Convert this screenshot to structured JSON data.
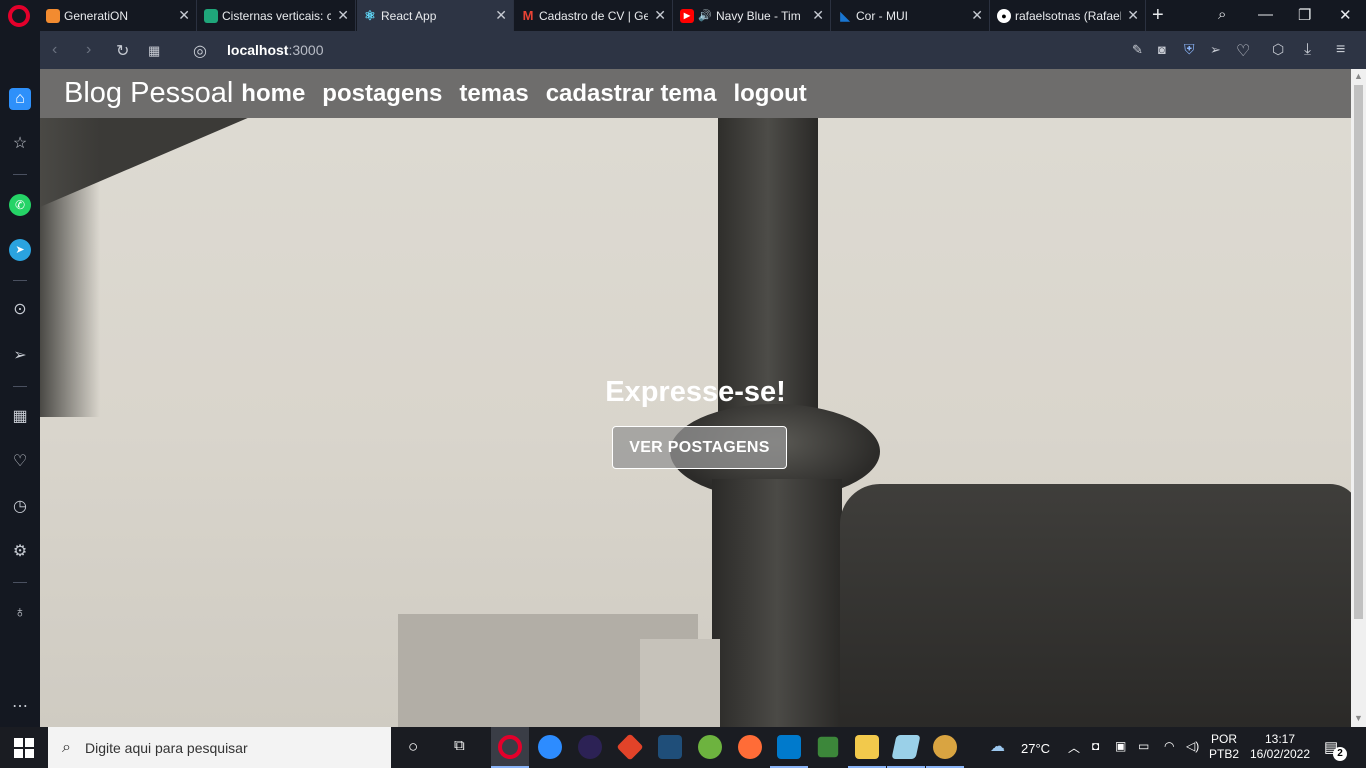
{
  "browser": {
    "tabs": [
      {
        "title": "GeneratiON",
        "favicon_color": "#f28b30",
        "active": false
      },
      {
        "title": "Cisternas verticais: c",
        "favicon_color": "#1fa67a",
        "active": false
      },
      {
        "title": "React App",
        "favicon_color": "#61dafb",
        "active": true
      },
      {
        "title": "Cadastro de CV | Ge",
        "favicon_color": "#ea4335",
        "active": false
      },
      {
        "title": "Navy Blue - Tim",
        "favicon_color": "#ff0000",
        "active": false
      },
      {
        "title": "Cor - MUI",
        "favicon_color": "#1976d2",
        "active": false
      },
      {
        "title": "rafaelsotnas (Rafael",
        "favicon_color": "#ffffff",
        "active": false
      }
    ],
    "address": {
      "host": "localhost",
      "port": ":3000"
    }
  },
  "page": {
    "navbar": {
      "brand": "Blog Pessoal",
      "items": [
        "home",
        "postagens",
        "temas",
        "cadastrar tema",
        "logout"
      ]
    },
    "hero": {
      "title": "Expresse-se!",
      "button": "VER POSTAGENS"
    }
  },
  "taskbar": {
    "search_placeholder": "Digite aqui para pesquisar",
    "weather": "27°C",
    "language": "POR",
    "keyboard": "PTB2",
    "time": "13:17",
    "date": "16/02/2022",
    "notifications": "2"
  }
}
